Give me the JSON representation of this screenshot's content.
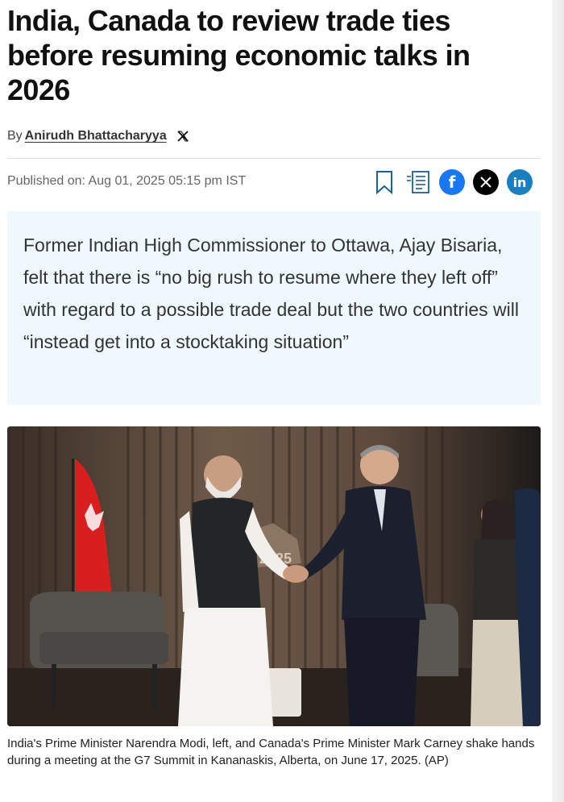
{
  "article": {
    "headline": "India, Canada to review trade ties before resuming economic talks in 2026",
    "byline_prefix": "By",
    "author": "Anirudh Bhattacharyya",
    "published": "Published on: Aug 01, 2025 05:15 pm IST",
    "summary": "Former Indian High Commissioner to Ottawa, Ajay Bisaria, felt that there is “no big rush to resume where they left off” with regard to a possible trade deal but the two countries will “instead get into a stocktaking situation”",
    "image_caption": "India's Prime Minister Narendra Modi, left, and Canada's Prime Minister Mark Carney shake hands during a meeting at the G7 Summit in Kananaskis, Alberta, on June 17, 2025. (AP)",
    "photo_sign_text": "2025"
  },
  "share": {
    "icons": [
      "bookmark-icon",
      "listen-icon",
      "facebook-icon",
      "x-icon",
      "linkedin-icon"
    ],
    "facebook_glyph": "f",
    "linkedin_glyph": "in"
  },
  "colors": {
    "summary_bg": "#eef8fd",
    "facebook": "#1877f2",
    "linkedin": "#1a7fc1",
    "x": "#000000"
  }
}
